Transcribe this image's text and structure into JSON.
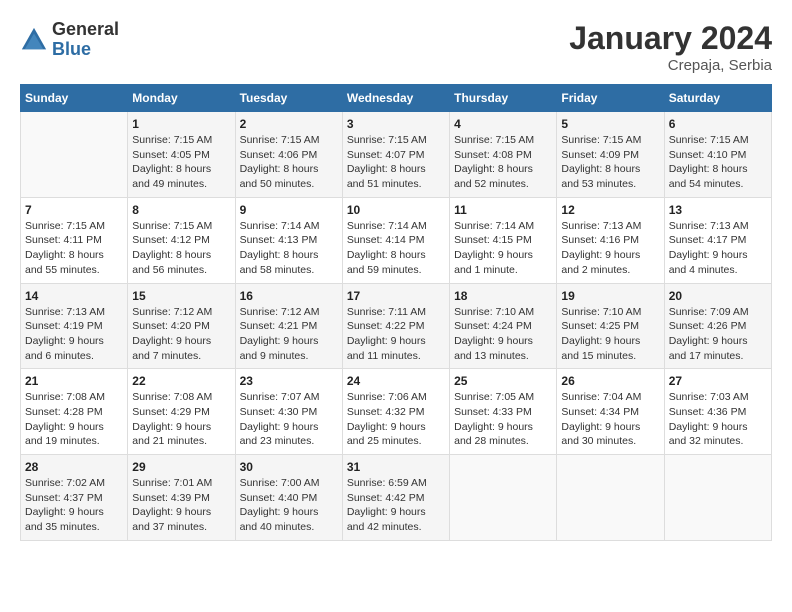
{
  "header": {
    "logo_general": "General",
    "logo_blue": "Blue",
    "month_year": "January 2024",
    "location": "Crepaja, Serbia"
  },
  "days_of_week": [
    "Sunday",
    "Monday",
    "Tuesday",
    "Wednesday",
    "Thursday",
    "Friday",
    "Saturday"
  ],
  "weeks": [
    [
      {
        "day": "",
        "sunrise": "",
        "sunset": "",
        "daylight": ""
      },
      {
        "day": "1",
        "sunrise": "Sunrise: 7:15 AM",
        "sunset": "Sunset: 4:05 PM",
        "daylight": "Daylight: 8 hours and 49 minutes."
      },
      {
        "day": "2",
        "sunrise": "Sunrise: 7:15 AM",
        "sunset": "Sunset: 4:06 PM",
        "daylight": "Daylight: 8 hours and 50 minutes."
      },
      {
        "day": "3",
        "sunrise": "Sunrise: 7:15 AM",
        "sunset": "Sunset: 4:07 PM",
        "daylight": "Daylight: 8 hours and 51 minutes."
      },
      {
        "day": "4",
        "sunrise": "Sunrise: 7:15 AM",
        "sunset": "Sunset: 4:08 PM",
        "daylight": "Daylight: 8 hours and 52 minutes."
      },
      {
        "day": "5",
        "sunrise": "Sunrise: 7:15 AM",
        "sunset": "Sunset: 4:09 PM",
        "daylight": "Daylight: 8 hours and 53 minutes."
      },
      {
        "day": "6",
        "sunrise": "Sunrise: 7:15 AM",
        "sunset": "Sunset: 4:10 PM",
        "daylight": "Daylight: 8 hours and 54 minutes."
      }
    ],
    [
      {
        "day": "7",
        "sunrise": "Sunrise: 7:15 AM",
        "sunset": "Sunset: 4:11 PM",
        "daylight": "Daylight: 8 hours and 55 minutes."
      },
      {
        "day": "8",
        "sunrise": "Sunrise: 7:15 AM",
        "sunset": "Sunset: 4:12 PM",
        "daylight": "Daylight: 8 hours and 56 minutes."
      },
      {
        "day": "9",
        "sunrise": "Sunrise: 7:14 AM",
        "sunset": "Sunset: 4:13 PM",
        "daylight": "Daylight: 8 hours and 58 minutes."
      },
      {
        "day": "10",
        "sunrise": "Sunrise: 7:14 AM",
        "sunset": "Sunset: 4:14 PM",
        "daylight": "Daylight: 8 hours and 59 minutes."
      },
      {
        "day": "11",
        "sunrise": "Sunrise: 7:14 AM",
        "sunset": "Sunset: 4:15 PM",
        "daylight": "Daylight: 9 hours and 1 minute."
      },
      {
        "day": "12",
        "sunrise": "Sunrise: 7:13 AM",
        "sunset": "Sunset: 4:16 PM",
        "daylight": "Daylight: 9 hours and 2 minutes."
      },
      {
        "day": "13",
        "sunrise": "Sunrise: 7:13 AM",
        "sunset": "Sunset: 4:17 PM",
        "daylight": "Daylight: 9 hours and 4 minutes."
      }
    ],
    [
      {
        "day": "14",
        "sunrise": "Sunrise: 7:13 AM",
        "sunset": "Sunset: 4:19 PM",
        "daylight": "Daylight: 9 hours and 6 minutes."
      },
      {
        "day": "15",
        "sunrise": "Sunrise: 7:12 AM",
        "sunset": "Sunset: 4:20 PM",
        "daylight": "Daylight: 9 hours and 7 minutes."
      },
      {
        "day": "16",
        "sunrise": "Sunrise: 7:12 AM",
        "sunset": "Sunset: 4:21 PM",
        "daylight": "Daylight: 9 hours and 9 minutes."
      },
      {
        "day": "17",
        "sunrise": "Sunrise: 7:11 AM",
        "sunset": "Sunset: 4:22 PM",
        "daylight": "Daylight: 9 hours and 11 minutes."
      },
      {
        "day": "18",
        "sunrise": "Sunrise: 7:10 AM",
        "sunset": "Sunset: 4:24 PM",
        "daylight": "Daylight: 9 hours and 13 minutes."
      },
      {
        "day": "19",
        "sunrise": "Sunrise: 7:10 AM",
        "sunset": "Sunset: 4:25 PM",
        "daylight": "Daylight: 9 hours and 15 minutes."
      },
      {
        "day": "20",
        "sunrise": "Sunrise: 7:09 AM",
        "sunset": "Sunset: 4:26 PM",
        "daylight": "Daylight: 9 hours and 17 minutes."
      }
    ],
    [
      {
        "day": "21",
        "sunrise": "Sunrise: 7:08 AM",
        "sunset": "Sunset: 4:28 PM",
        "daylight": "Daylight: 9 hours and 19 minutes."
      },
      {
        "day": "22",
        "sunrise": "Sunrise: 7:08 AM",
        "sunset": "Sunset: 4:29 PM",
        "daylight": "Daylight: 9 hours and 21 minutes."
      },
      {
        "day": "23",
        "sunrise": "Sunrise: 7:07 AM",
        "sunset": "Sunset: 4:30 PM",
        "daylight": "Daylight: 9 hours and 23 minutes."
      },
      {
        "day": "24",
        "sunrise": "Sunrise: 7:06 AM",
        "sunset": "Sunset: 4:32 PM",
        "daylight": "Daylight: 9 hours and 25 minutes."
      },
      {
        "day": "25",
        "sunrise": "Sunrise: 7:05 AM",
        "sunset": "Sunset: 4:33 PM",
        "daylight": "Daylight: 9 hours and 28 minutes."
      },
      {
        "day": "26",
        "sunrise": "Sunrise: 7:04 AM",
        "sunset": "Sunset: 4:34 PM",
        "daylight": "Daylight: 9 hours and 30 minutes."
      },
      {
        "day": "27",
        "sunrise": "Sunrise: 7:03 AM",
        "sunset": "Sunset: 4:36 PM",
        "daylight": "Daylight: 9 hours and 32 minutes."
      }
    ],
    [
      {
        "day": "28",
        "sunrise": "Sunrise: 7:02 AM",
        "sunset": "Sunset: 4:37 PM",
        "daylight": "Daylight: 9 hours and 35 minutes."
      },
      {
        "day": "29",
        "sunrise": "Sunrise: 7:01 AM",
        "sunset": "Sunset: 4:39 PM",
        "daylight": "Daylight: 9 hours and 37 minutes."
      },
      {
        "day": "30",
        "sunrise": "Sunrise: 7:00 AM",
        "sunset": "Sunset: 4:40 PM",
        "daylight": "Daylight: 9 hours and 40 minutes."
      },
      {
        "day": "31",
        "sunrise": "Sunrise: 6:59 AM",
        "sunset": "Sunset: 4:42 PM",
        "daylight": "Daylight: 9 hours and 42 minutes."
      },
      {
        "day": "",
        "sunrise": "",
        "sunset": "",
        "daylight": ""
      },
      {
        "day": "",
        "sunrise": "",
        "sunset": "",
        "daylight": ""
      },
      {
        "day": "",
        "sunrise": "",
        "sunset": "",
        "daylight": ""
      }
    ]
  ]
}
